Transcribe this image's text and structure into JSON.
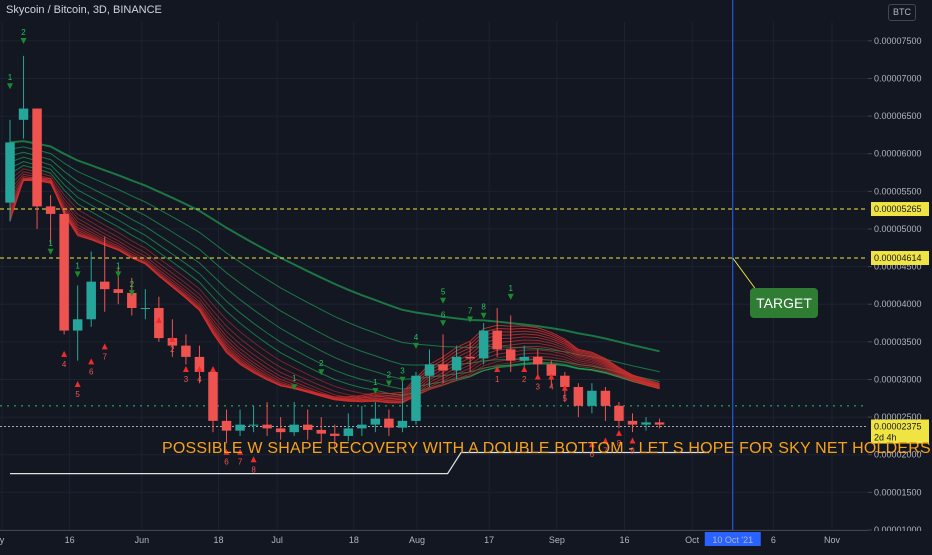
{
  "header": {
    "title": "Skycoin / Bitcoin, 3D, BINANCE",
    "currency": "BTC"
  },
  "colors": {
    "bg": "#131722",
    "up": "#26a69a",
    "down": "#ef5350",
    "ribbon_red": "#d32f2f",
    "ribbon_green": "#22c55e",
    "level": "#f0e442",
    "accent": "#f7a21b",
    "target_line": "#2962ff"
  },
  "chart_data": {
    "type": "candlestick",
    "ylim": [
      1e-05,
      7.75e-05
    ],
    "y_ticks": [
      "0.00007500",
      "0.00007000",
      "0.00006500",
      "0.00006000",
      "0.00005500",
      "0.00005000",
      "0.00004500",
      "0.00004000",
      "0.00003500",
      "0.00003000",
      "0.00002500",
      "0.00002000",
      "0.00001500",
      "0.00001000"
    ],
    "x_ticks": [
      {
        "label": "y",
        "day": 0
      },
      {
        "label": "16",
        "day": 15
      },
      {
        "label": "Jun",
        "day": 31
      },
      {
        "label": "18",
        "day": 48
      },
      {
        "label": "Jul",
        "day": 61
      },
      {
        "label": "18",
        "day": 78
      },
      {
        "label": "Aug",
        "day": 92
      },
      {
        "label": "17",
        "day": 108
      },
      {
        "label": "Sep",
        "day": 123
      },
      {
        "label": "16",
        "day": 138
      },
      {
        "label": "Oct",
        "day": 153
      },
      {
        "label": "6",
        "day": 171
      },
      {
        "label": "Nov",
        "day": 184
      }
    ],
    "target_date_label": "10 Oct '21",
    "target_day": 162,
    "candles": [
      [
        5.35e-05,
        6.15e-05,
        5.1e-05,
        6.45e-05
      ],
      [
        6.45e-05,
        6.6e-05,
        6.2e-05,
        7.3e-05
      ],
      [
        6.6e-05,
        5.3e-05,
        5e-05,
        6.6e-05
      ],
      [
        5.3e-05,
        5.2e-05,
        4.8e-05,
        5.45e-05
      ],
      [
        5.2e-05,
        3.65e-05,
        3.6e-05,
        5.25e-05
      ],
      [
        3.65e-05,
        3.8e-05,
        3.25e-05,
        4.25e-05
      ],
      [
        3.8e-05,
        4.3e-05,
        3.7e-05,
        4.7e-05
      ],
      [
        4.3e-05,
        4.2e-05,
        3.9e-05,
        4.9e-05
      ],
      [
        4.2e-05,
        4.15e-05,
        4e-05,
        4.5e-05
      ],
      [
        4.15e-05,
        3.95e-05,
        3.85e-05,
        4.35e-05
      ],
      [
        3.95e-05,
        3.95e-05,
        3.8e-05,
        4.2e-05
      ],
      [
        3.95e-05,
        3.55e-05,
        3.5e-05,
        4.1e-05
      ],
      [
        3.55e-05,
        3.45e-05,
        3.3e-05,
        3.8e-05
      ],
      [
        3.45e-05,
        3.3e-05,
        3.2e-05,
        3.6e-05
      ],
      [
        3.3e-05,
        3.1e-05,
        2.95e-05,
        3.45e-05
      ],
      [
        3.1e-05,
        2.45e-05,
        2.3e-05,
        3.1e-05
      ],
      [
        2.45e-05,
        2.32e-05,
        2.15e-05,
        2.6e-05
      ],
      [
        2.32e-05,
        2.4e-05,
        2.25e-05,
        2.6e-05
      ],
      [
        2.4e-05,
        2.4e-05,
        2.3e-05,
        2.65e-05
      ],
      [
        2.4e-05,
        2.35e-05,
        2.25e-05,
        2.7e-05
      ],
      [
        2.35e-05,
        2.3e-05,
        2.2e-05,
        2.5e-05
      ],
      [
        2.3e-05,
        2.4e-05,
        2.25e-05,
        2.7e-05
      ],
      [
        2.4e-05,
        2.33e-05,
        2.2e-05,
        2.6e-05
      ],
      [
        2.33e-05,
        2.28e-05,
        2.15e-05,
        2.5e-05
      ],
      [
        2.28e-05,
        2.25e-05,
        2.1e-05,
        2.4e-05
      ],
      [
        2.25e-05,
        2.35e-05,
        2.18e-05,
        2.55e-05
      ],
      [
        2.35e-05,
        2.4e-05,
        2.25e-05,
        2.65e-05
      ],
      [
        2.4e-05,
        2.48e-05,
        2.3e-05,
        2.7e-05
      ],
      [
        2.48e-05,
        2.36e-05,
        2.25e-05,
        2.6e-05
      ],
      [
        2.36e-05,
        2.45e-05,
        2.3e-05,
        3e-05
      ],
      [
        2.45e-05,
        3.05e-05,
        2.4e-05,
        3.1e-05
      ],
      [
        3.05e-05,
        3.2e-05,
        2.9e-05,
        3.4e-05
      ],
      [
        3.2e-05,
        3.12e-05,
        2.95e-05,
        3.6e-05
      ],
      [
        3.12e-05,
        3.3e-05,
        3e-05,
        3.45e-05
      ],
      [
        3.3e-05,
        3.28e-05,
        3.1e-05,
        3.5e-05
      ],
      [
        3.28e-05,
        3.65e-05,
        3.2e-05,
        3.75e-05
      ],
      [
        3.65e-05,
        3.4e-05,
        3.3e-05,
        3.95e-05
      ],
      [
        3.4e-05,
        3.25e-05,
        3.1e-05,
        3.85e-05
      ],
      [
        3.25e-05,
        3.3e-05,
        3.15e-05,
        3.45e-05
      ],
      [
        3.3e-05,
        3.2e-05,
        3.05e-05,
        3.4e-05
      ],
      [
        3.2e-05,
        3.05e-05,
        2.9e-05,
        3.25e-05
      ],
      [
        3.05e-05,
        2.9e-05,
        2.7e-05,
        3.1e-05
      ],
      [
        2.9e-05,
        2.65e-05,
        2.5e-05,
        2.95e-05
      ],
      [
        2.65e-05,
        2.85e-05,
        2.55e-05,
        2.95e-05
      ],
      [
        2.85e-05,
        2.65e-05,
        2.45e-05,
        2.9e-05
      ],
      [
        2.65e-05,
        2.45e-05,
        2.35e-05,
        2.7e-05
      ],
      [
        2.45e-05,
        2.4e-05,
        2.3e-05,
        2.55e-05
      ],
      [
        2.4e-05,
        2.43e-05,
        2.32e-05,
        2.5e-05
      ],
      [
        2.43e-05,
        2.4e-05,
        2.35e-05,
        2.48e-05
      ]
    ],
    "levels": [
      {
        "label": "0.00005265",
        "value": 5.265e-05
      },
      {
        "label": "0.00004614",
        "value": 4.614e-05
      }
    ],
    "current_price": {
      "label": "0.00002375",
      "value": 2.375e-05,
      "countdown": "2d 4h"
    },
    "support_dotted": 2.65e-05,
    "white_line": [
      [
        0,
        1.75e-05
      ],
      [
        97,
        1.75e-05
      ],
      [
        100,
        2.03e-05
      ],
      [
        155,
        2.03e-05
      ]
    ],
    "signals": [
      {
        "t": "2",
        "i": 1,
        "y": 7.55e-05,
        "up": false
      },
      {
        "t": "1",
        "i": 0,
        "y": 6.95e-05,
        "up": false
      },
      {
        "t": "1",
        "i": 3,
        "y": 4.75e-05,
        "up": false
      },
      {
        "t": "1",
        "i": 5,
        "y": 4.45e-05,
        "up": false
      },
      {
        "t": "4",
        "i": 4,
        "y": 3.3e-05,
        "up": true
      },
      {
        "t": "5",
        "i": 5,
        "y": 2.9e-05,
        "up": true
      },
      {
        "t": "6",
        "i": 6,
        "y": 3.2e-05,
        "up": true
      },
      {
        "t": "7",
        "i": 7,
        "y": 3.4e-05,
        "up": true
      },
      {
        "t": "1",
        "i": 8,
        "y": 4.45e-05,
        "up": false
      },
      {
        "t": "2",
        "i": 9,
        "y": 4.2e-05,
        "up": false
      },
      {
        "t": "1",
        "i": 11,
        "y": 3.75e-05,
        "up": true
      },
      {
        "t": "2",
        "i": 12,
        "y": 3.5e-05,
        "up": true
      },
      {
        "t": "3",
        "i": 13,
        "y": 3.1e-05,
        "up": true
      },
      {
        "t": "4",
        "i": 14,
        "y": 3.1e-05,
        "up": true
      },
      {
        "t": "5",
        "i": 15,
        "y": 3.1e-05,
        "up": true
      },
      {
        "t": "6",
        "i": 16,
        "y": 2e-05,
        "up": true
      },
      {
        "t": "7",
        "i": 17,
        "y": 2e-05,
        "up": true
      },
      {
        "t": "8",
        "i": 18,
        "y": 1.9e-05,
        "up": true
      },
      {
        "t": "1",
        "i": 21,
        "y": 2.95e-05,
        "up": false
      },
      {
        "t": "2",
        "i": 23,
        "y": 3.15e-05,
        "up": false
      },
      {
        "t": "1",
        "i": 27,
        "y": 2.9e-05,
        "up": false
      },
      {
        "t": "2",
        "i": 28,
        "y": 3e-05,
        "up": false
      },
      {
        "t": "3",
        "i": 29,
        "y": 3.05e-05,
        "up": false
      },
      {
        "t": "4",
        "i": 30,
        "y": 3.5e-05,
        "up": false
      },
      {
        "t": "5",
        "i": 32,
        "y": 4.1e-05,
        "up": false
      },
      {
        "t": "6",
        "i": 32,
        "y": 3.8e-05,
        "up": false
      },
      {
        "t": "7",
        "i": 34,
        "y": 3.85e-05,
        "up": false
      },
      {
        "t": "8",
        "i": 35,
        "y": 3.9e-05,
        "up": false
      },
      {
        "t": "1",
        "i": 37,
        "y": 4.15e-05,
        "up": false
      },
      {
        "t": "1",
        "i": 36,
        "y": 3.1e-05,
        "up": true
      },
      {
        "t": "2",
        "i": 38,
        "y": 3.1e-05,
        "up": true
      },
      {
        "t": "3",
        "i": 39,
        "y": 3e-05,
        "up": true
      },
      {
        "t": "4",
        "i": 40,
        "y": 3e-05,
        "up": true
      },
      {
        "t": "5",
        "i": 41,
        "y": 2.85e-05,
        "up": true
      },
      {
        "t": "6",
        "i": 43,
        "y": 2.1e-05,
        "up": true
      },
      {
        "t": "7",
        "i": 44,
        "y": 2.15e-05,
        "up": true
      },
      {
        "t": "8",
        "i": 45,
        "y": 2.25e-05,
        "up": true
      },
      {
        "t": "9",
        "i": 46,
        "y": 2.15e-05,
        "up": true
      }
    ]
  },
  "annotations": {
    "headline": "POSSIBLE W SHAPE RECOVERY WITH A DOUBLE BOTTOM - LET S HOPE FOR SKY NET HOLDERS",
    "target": "TARGET"
  }
}
